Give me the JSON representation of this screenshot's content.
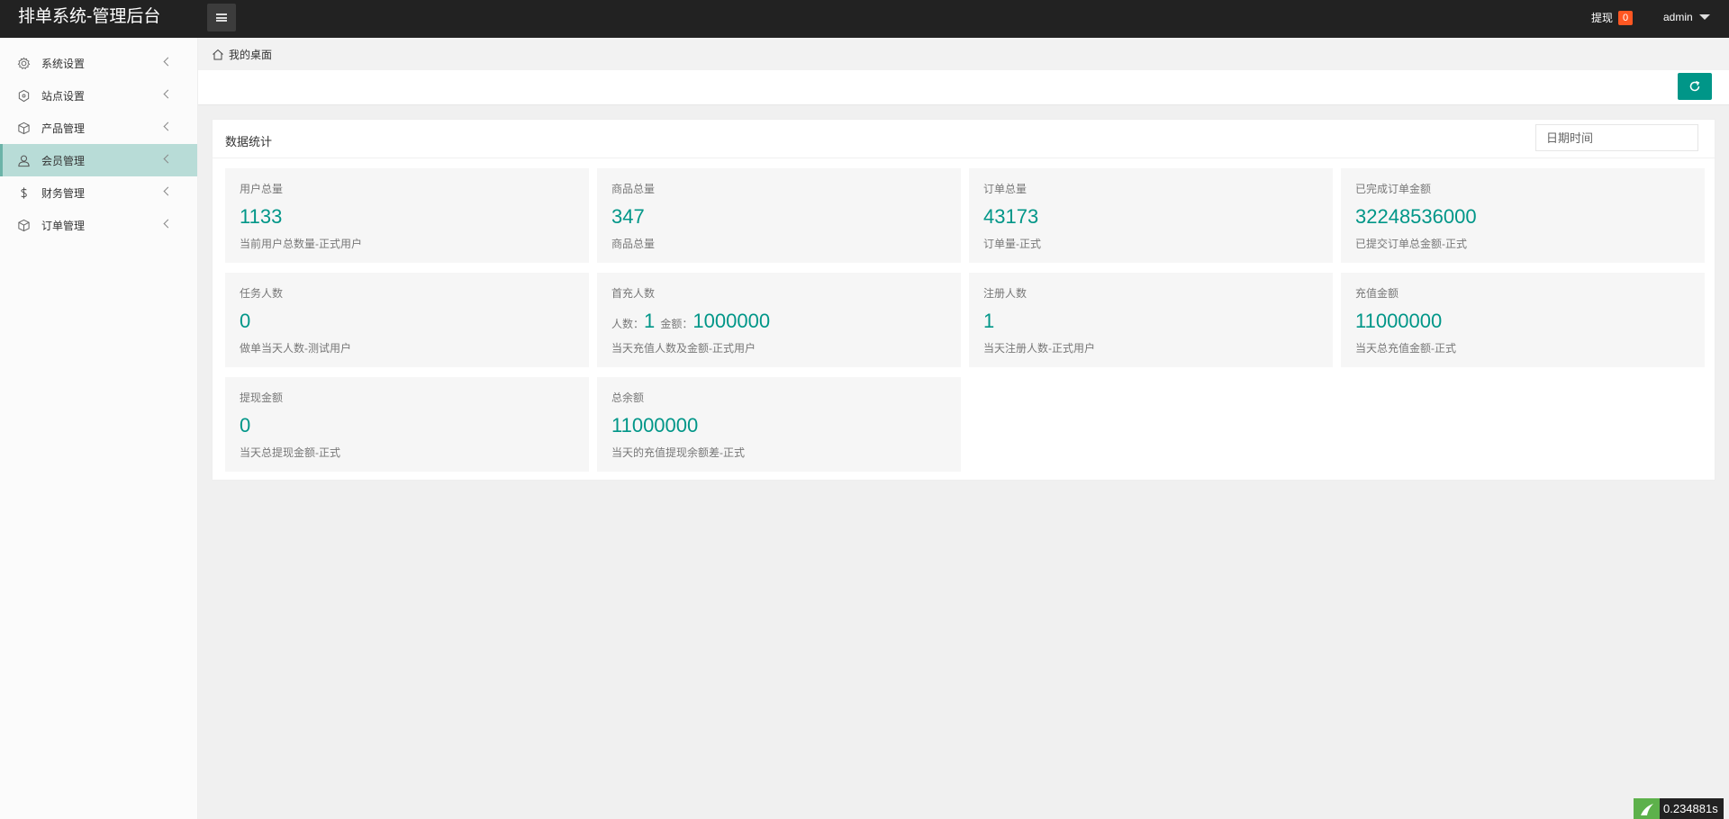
{
  "header": {
    "title": "排单系统-管理后台",
    "withdraw_label": "提现",
    "withdraw_badge": "0",
    "user_name": "admin"
  },
  "sidebar": {
    "items": [
      {
        "label": "系统设置",
        "icon": "gear-icon"
      },
      {
        "label": "站点设置",
        "icon": "globe-icon"
      },
      {
        "label": "产品管理",
        "icon": "box-icon"
      },
      {
        "label": "会员管理",
        "icon": "user-icon",
        "active": true
      },
      {
        "label": "财务管理",
        "icon": "dollar-icon"
      },
      {
        "label": "订单管理",
        "icon": "box-icon"
      }
    ]
  },
  "breadcrumb": {
    "label": "我的桌面"
  },
  "panel": {
    "title": "数据统计",
    "date_placeholder": "日期时间"
  },
  "cards": [
    {
      "label": "用户总量",
      "value": "1133",
      "desc": "当前用户总数量-正式用户"
    },
    {
      "label": "商品总量",
      "value": "347",
      "desc": "商品总量"
    },
    {
      "label": "订单总量",
      "value": "43173",
      "desc": "订单量-正式"
    },
    {
      "label": "已完成订单金额",
      "value": "32248536000",
      "desc": "已提交订单总金额-正式"
    },
    {
      "label": "任务人数",
      "value": "0",
      "desc": "做单当天人数-测试用户"
    },
    {
      "label": "首充人数",
      "people_label": "人数：",
      "people": "1",
      "amount_label": "金额：",
      "amount": "1000000",
      "desc": "当天充值人数及金额-正式用户"
    },
    {
      "label": "注册人数",
      "value": "1",
      "desc": "当天注册人数-正式用户"
    },
    {
      "label": "充值金额",
      "value": "11000000",
      "desc": "当天总充值金额-正式"
    },
    {
      "label": "提现金额",
      "value": "0",
      "desc": "当天总提现金额-正式"
    },
    {
      "label": "总余额",
      "value": "11000000",
      "desc": "当天的充值提现余额差-正式"
    }
  ],
  "footer": {
    "timer": "0.234881s"
  },
  "colors": {
    "accent": "#009688",
    "header_bg": "#222222",
    "active_nav": "#b8dcd7",
    "badge": "#ff5722"
  }
}
